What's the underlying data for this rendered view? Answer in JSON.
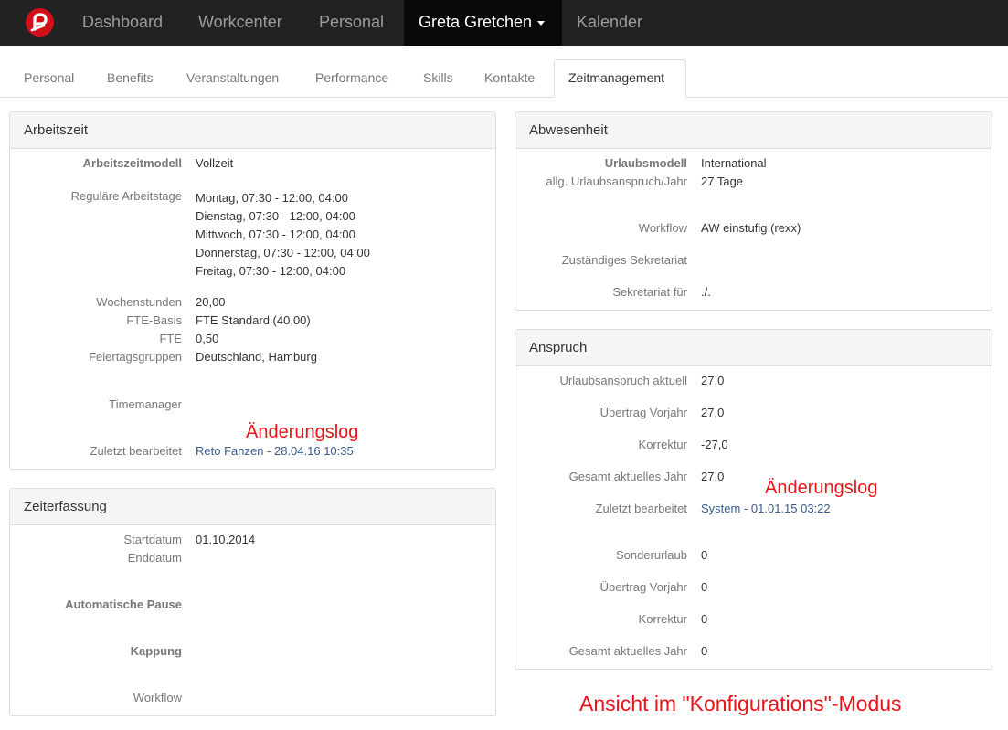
{
  "navbar": {
    "items": [
      "Dashboard",
      "Workcenter",
      "Personal"
    ],
    "user": "Greta Gretchen",
    "calendar": "Kalender"
  },
  "tabs": [
    "Personal",
    "Benefits",
    "Veranstaltungen",
    "Performance",
    "Skills",
    "Kontakte",
    "Zeitmanagement"
  ],
  "arbeitszeit": {
    "title": "Arbeitszeit",
    "modell_label": "Arbeitszeitmodell",
    "modell_value": "Vollzeit",
    "tage_label": "Reguläre Arbeitstage",
    "tage": [
      "Montag, 07:30 - 12:00, 04:00",
      "Dienstag, 07:30 - 12:00, 04:00",
      "Mittwoch, 07:30 - 12:00, 04:00",
      "Donnerstag, 07:30 - 12:00, 04:00",
      "Freitag, 07:30 - 12:00, 04:00"
    ],
    "wochenstunden_label": "Wochenstunden",
    "wochenstunden_value": "20,00",
    "fte_basis_label": "FTE-Basis",
    "fte_basis_value": "FTE Standard (40,00)",
    "fte_label": "FTE",
    "fte_value": "0,50",
    "feiertag_label": "Feiertagsgruppen",
    "feiertag_value": "Deutschland, Hamburg",
    "timemanager_label": "Timemanager",
    "zuletzt_label": "Zuletzt bearbeitet",
    "zuletzt_value": "Reto Fanzen - 28.04.16 10:35"
  },
  "zeiterfassung": {
    "title": "Zeiterfassung",
    "start_label": "Startdatum",
    "start_value": "01.10.2014",
    "ende_label": "Enddatum",
    "pause_label": "Automatische Pause",
    "kappung_label": "Kappung",
    "workflow_label": "Workflow"
  },
  "abwesenheit": {
    "title": "Abwesenheit",
    "urlaubsmodell_label": "Urlaubsmodell",
    "urlaubsmodell_value": "International",
    "anspruch_label": "allg. Urlaubsanspruch/Jahr",
    "anspruch_value": "27 Tage",
    "workflow_label": "Workflow",
    "workflow_value": "AW einstufig (rexx)",
    "sekretariat_label": "Zuständiges Sekretariat",
    "sekretariat_fuer_label": "Sekretariat für",
    "sekretariat_fuer_value": "./."
  },
  "anspruch": {
    "title": "Anspruch",
    "rows_top": [
      {
        "label": "Urlaubsanspruch aktuell",
        "value": "27,0"
      },
      {
        "label": "Übertrag Vorjahr",
        "value": "27,0"
      },
      {
        "label": "Korrektur",
        "value": "-27,0"
      },
      {
        "label": "Gesamt aktuelles Jahr",
        "value": "27,0"
      }
    ],
    "zuletzt_label": "Zuletzt bearbeitet",
    "zuletzt_value": "System - 01.01.15 03:22",
    "rows_bottom": [
      {
        "label": "Sonderurlaub",
        "value": "0"
      },
      {
        "label": "Übertrag Vorjahr",
        "value": "0"
      },
      {
        "label": "Korrektur",
        "value": "0"
      },
      {
        "label": "Gesamt aktuelles Jahr",
        "value": "0"
      }
    ]
  },
  "annotations": {
    "log1": "Änderungslog",
    "log2": "Änderungslog",
    "mode": "Ansicht im \"Konfigurations\"-Modus"
  },
  "colors": {
    "brand": "#d0101a",
    "annotation": "#e8141b",
    "link": "#3a5a8c"
  }
}
